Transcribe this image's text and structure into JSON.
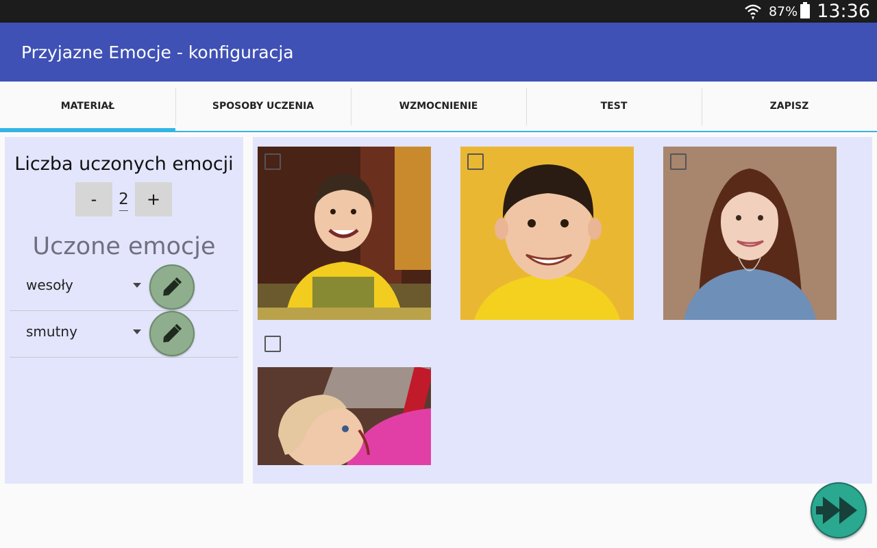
{
  "status_bar": {
    "battery_percent": "87%",
    "time": "13:36",
    "icons": [
      "wifi-icon",
      "battery-icon"
    ]
  },
  "app_bar": {
    "title": "Przyjazne Emocje - konfiguracja",
    "color": "#3f51b5"
  },
  "tabs": [
    {
      "label": "MATERIAŁ",
      "active": true
    },
    {
      "label": "SPOSOBY UCZENIA",
      "active": false
    },
    {
      "label": "WZMOCNIENIE",
      "active": false
    },
    {
      "label": "TEST",
      "active": false
    },
    {
      "label": "ZAPISZ",
      "active": false
    }
  ],
  "left_panel": {
    "count_label": "Liczba uczonych emocji",
    "decrement_label": "-",
    "count_value": "2",
    "increment_label": "+",
    "emotions_heading": "Uczone emocje",
    "emotions": [
      {
        "value": "wesoły",
        "edit_icon": "pencil-icon"
      },
      {
        "value": "smutny",
        "edit_icon": "pencil-icon"
      }
    ]
  },
  "photos": [
    {
      "description_icon": "photo-boy-smiling-table",
      "checked": false
    },
    {
      "description_icon": "photo-boy-smiling-yellow",
      "checked": false
    },
    {
      "description_icon": "photo-woman-smiling",
      "checked": false
    },
    {
      "description_icon": "photo-girl-smiling-playground",
      "checked": false
    }
  ],
  "next_button": {
    "icon": "fast-forward-icon"
  },
  "colors": {
    "accent": "#33b5e5",
    "panel_bg": "#e3e5fc",
    "edit_fab": "#8fae8d",
    "next_fab": "#2aa890"
  }
}
